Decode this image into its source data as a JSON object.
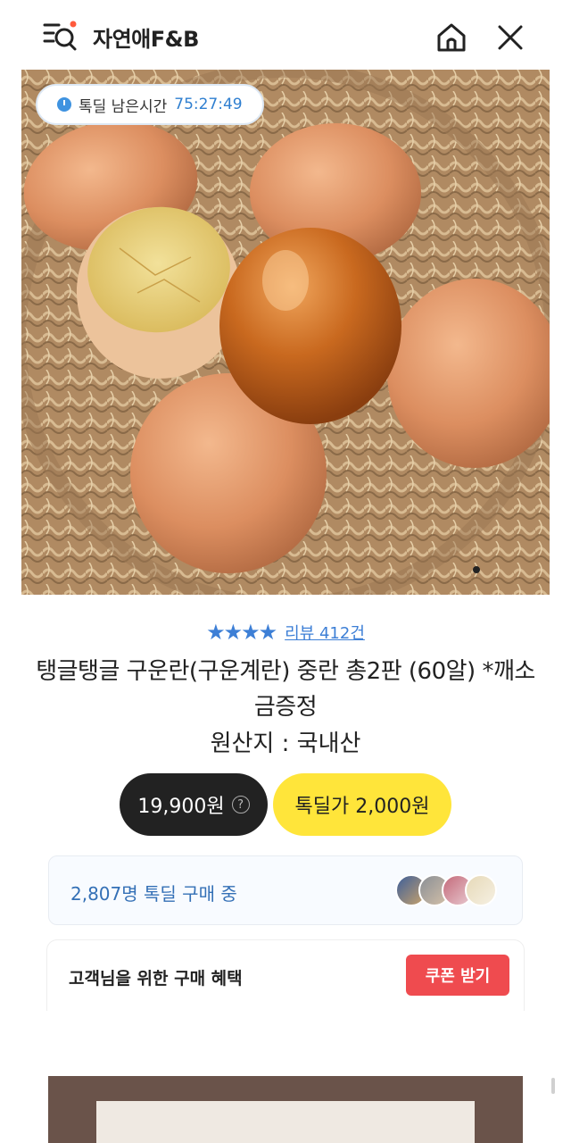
{
  "header": {
    "store_name": "자연애F&B",
    "icons": [
      "menu-search-icon",
      "home-icon",
      "close-icon"
    ]
  },
  "product_image": {
    "timer_label": "톡딜 남은시간",
    "timer_value": "75:27:49"
  },
  "product": {
    "rating_stars": 4,
    "stars_text": "★★★★",
    "review_label": "리뷰 412건",
    "title": "탱글탱글 구운란(구운계란) 중란 총2판 (60알) *깨소금증정",
    "origin": "원산지 : 국내산"
  },
  "pricing": {
    "regular_price": "19,900원",
    "help_glyph": "?",
    "deal_price": "톡딜가 2,000원"
  },
  "buyers": {
    "text": "2,807명 톡딜 구매 중"
  },
  "benefit": {
    "label": "고객님을 위한 구매 혜택",
    "coupon_button": "쿠폰 받기"
  },
  "detail_banner": {
    "partial_text": "~~~~~~~~~~~~~~~"
  },
  "colors": {
    "accent_blue": "#3d7fd6",
    "deal_yellow": "#ffe53a",
    "coupon_red": "#ef4b4f",
    "price_dark": "#222222"
  }
}
